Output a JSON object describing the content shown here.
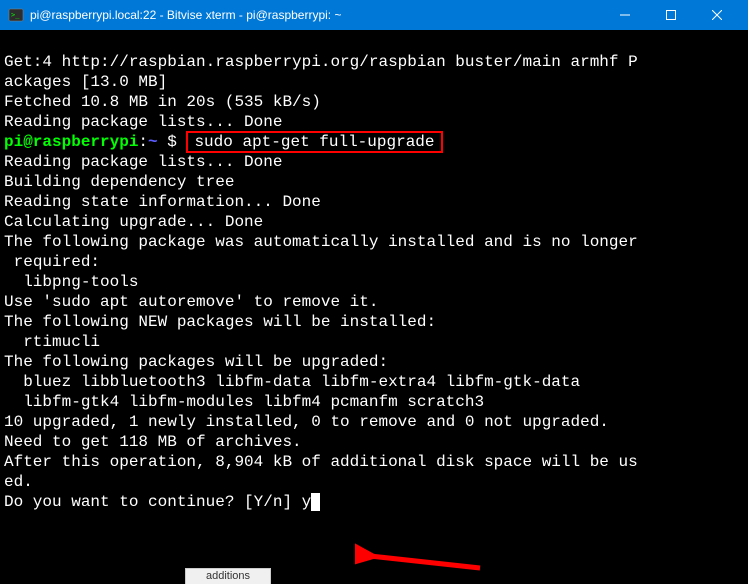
{
  "titlebar": {
    "title": "pi@raspberrypi.local:22 - Bitvise xterm - pi@raspberrypi: ~"
  },
  "terminal": {
    "line1": "Get:4 http://raspbian.raspberrypi.org/raspbian buster/main armhf P",
    "line2": "ackages [13.0 MB]",
    "line3": "Fetched 10.8 MB in 20s (535 kB/s)",
    "line4": "Reading package lists... Done",
    "prompt_user": "pi@raspberrypi",
    "prompt_path": "~",
    "prompt_dollar": " $ ",
    "command": "sudo apt-get full-upgrade",
    "line6": "Reading package lists... Done",
    "line7": "Building dependency tree",
    "line8": "Reading state information... Done",
    "line9": "Calculating upgrade... Done",
    "line10": "The following package was automatically installed and is no longer",
    "line11": " required:",
    "line12": "  libpng-tools",
    "line13": "Use 'sudo apt autoremove' to remove it.",
    "line14": "The following NEW packages will be installed:",
    "line15": "  rtimucli",
    "line16": "The following packages will be upgraded:",
    "line17": "  bluez libbluetooth3 libfm-data libfm-extra4 libfm-gtk-data",
    "line18": "  libfm-gtk4 libfm-modules libfm4 pcmanfm scratch3",
    "line19": "10 upgraded, 1 newly installed, 0 to remove and 0 not upgraded.",
    "line20": "Need to get 118 MB of archives.",
    "line21": "After this operation, 8,904 kB of additional disk space will be us",
    "line22": "ed.",
    "line23": "Do you want to continue? [Y/n] ",
    "input_answer": "y"
  },
  "bottom_tab": "additions"
}
